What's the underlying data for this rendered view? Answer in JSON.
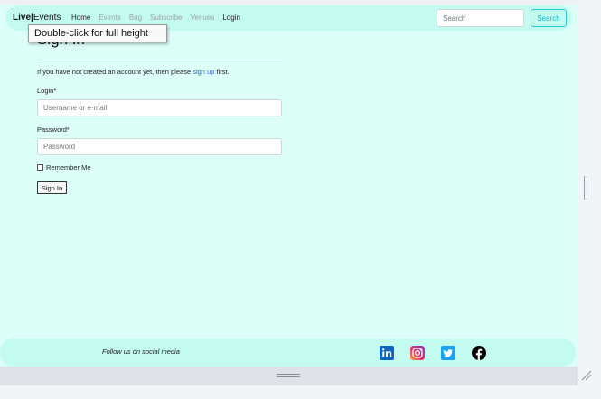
{
  "header": {
    "brand_live": "Live",
    "brand_separator": "|",
    "brand_events": "Events",
    "nav": [
      {
        "label": "Home",
        "active": true
      },
      {
        "label": "Events",
        "active": false
      },
      {
        "label": "Bag",
        "active": false
      },
      {
        "label": "Subscribe",
        "active": false
      },
      {
        "label": "Venues",
        "active": false
      },
      {
        "label": "Login",
        "active": true
      }
    ],
    "search_placeholder": "Search",
    "search_button": "Search"
  },
  "tooltip": "Double-click for full height",
  "signin": {
    "title": "Sign In",
    "intro_before": "If you have not created an account yet, then please ",
    "intro_link": "sign up",
    "intro_after": " first.",
    "login_label": "Login*",
    "login_placeholder": "Username or e-mail",
    "password_label": "Password*",
    "password_placeholder": "Password",
    "remember_label": "Remember Me",
    "button": "Sign In"
  },
  "footer": {
    "follow_text": "Follow us on social media",
    "social_icons": [
      "linkedin-icon",
      "instagram-icon",
      "twitter-icon",
      "facebook-icon"
    ]
  },
  "colors": {
    "page_bg": "#dcfff8",
    "nav_bg": "#c4fbf1",
    "accent": "#19b3c0",
    "link": "#2a63cc",
    "linkedin": "#0a66c2",
    "twitter": "#1da1f2",
    "facebook": "#000000"
  }
}
